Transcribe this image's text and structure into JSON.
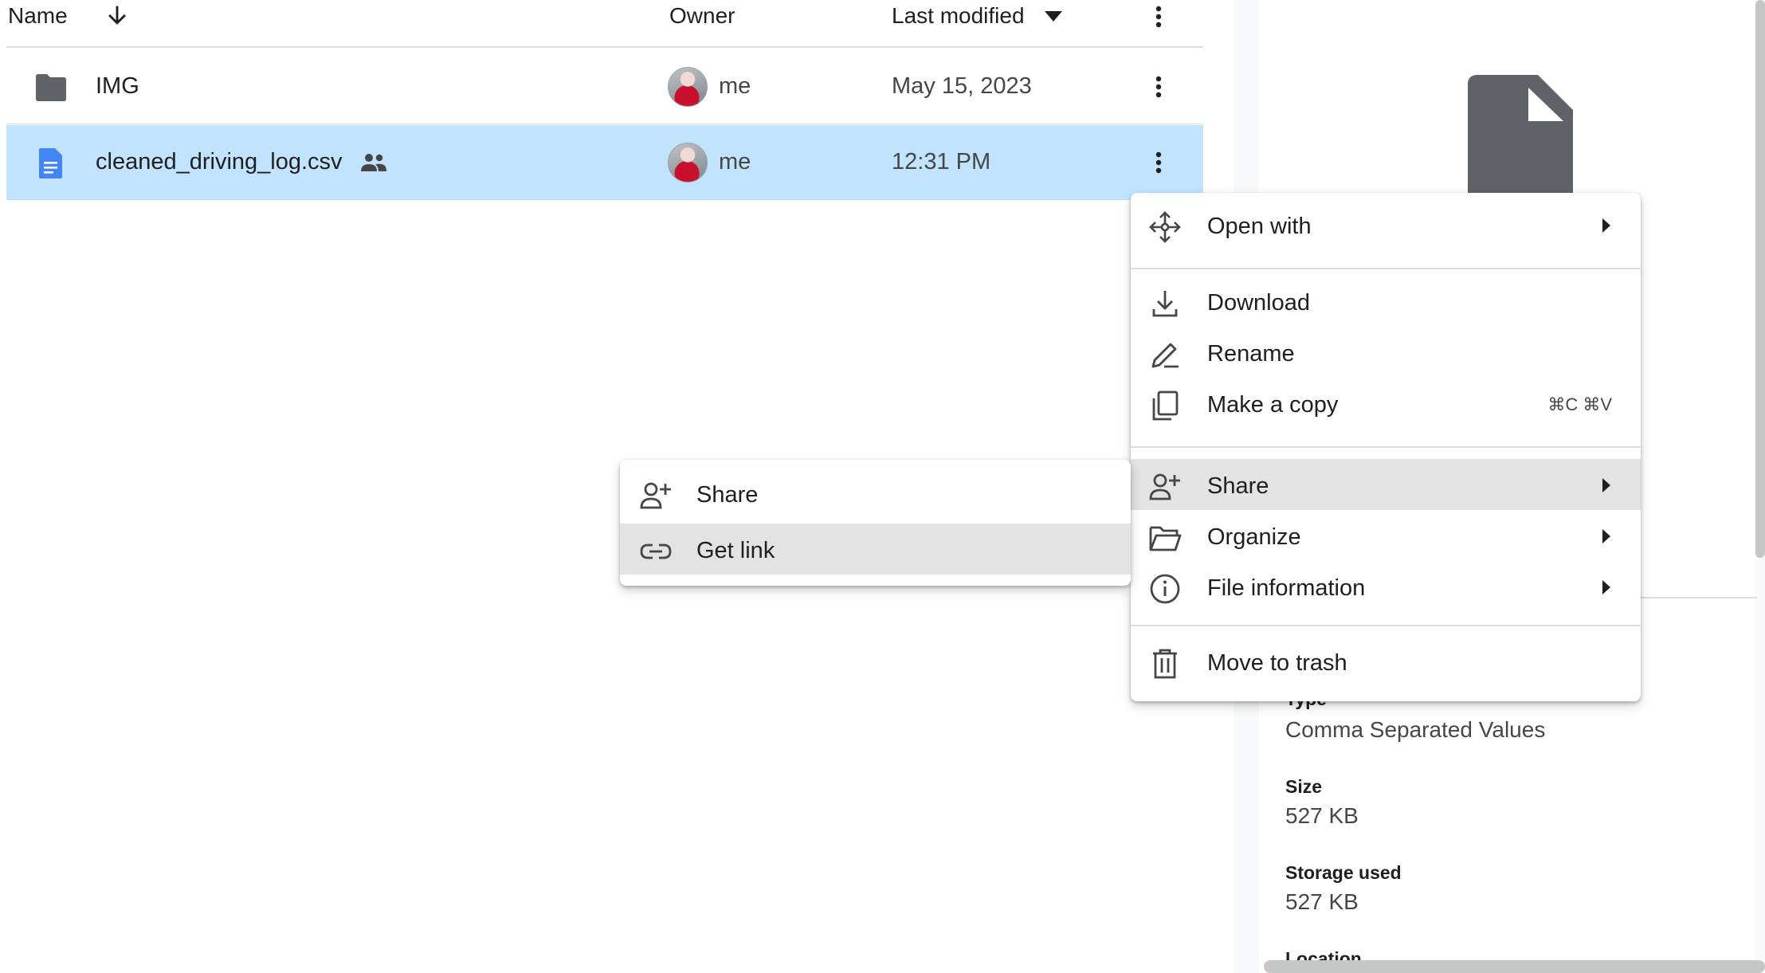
{
  "list": {
    "headers": {
      "name": "Name",
      "owner": "Owner",
      "last_modified": "Last modified"
    },
    "rows": [
      {
        "name": "IMG",
        "icon": "folder-icon",
        "owner": "me",
        "modified": "May 15, 2023",
        "selected": false
      },
      {
        "name": "cleaned_driving_log.csv",
        "icon": "document-icon",
        "shared_icon": "people-icon",
        "owner": "me",
        "modified": "12:31 PM",
        "selected": true
      }
    ]
  },
  "context_menu": {
    "items": {
      "open_with": "Open with",
      "download": "Download",
      "rename": "Rename",
      "make_copy": "Make a copy",
      "make_copy_shortcut": "⌘C ⌘V",
      "share": "Share",
      "organize": "Organize",
      "file_information": "File information",
      "move_to_trash": "Move to trash"
    },
    "highlighted": "Share"
  },
  "share_submenu": {
    "items": {
      "share": "Share",
      "get_link": "Get link"
    },
    "highlighted": "Get link"
  },
  "details": {
    "type_label": "Type",
    "type_value": "Comma Separated Values",
    "size_label": "Size",
    "size_value": "527 KB",
    "storage_label": "Storage used",
    "storage_value": "527 KB",
    "location_label": "Location"
  },
  "colors": {
    "selected_row": "#c2e3fd",
    "menu_highlight": "#e3e3e3",
    "doc_icon_blue": "#4285f4",
    "icon_gray": "#5f6368"
  }
}
